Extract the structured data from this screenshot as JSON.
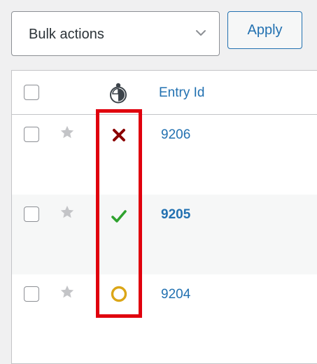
{
  "toolbar": {
    "bulk_actions_selected": "Bulk actions",
    "apply_label": "Apply"
  },
  "table": {
    "columns": {
      "entry_id": "Entry Id"
    },
    "rows": [
      {
        "entry_id": "9206",
        "status": "rejected",
        "status_icon": "x-mark-icon",
        "status_color": "#8b0000",
        "bold": false
      },
      {
        "entry_id": "9205",
        "status": "approved",
        "status_icon": "check-mark-icon",
        "status_color": "#2ea22e",
        "bold": true
      },
      {
        "entry_id": "9204",
        "status": "pending",
        "status_icon": "circle-icon",
        "status_color": "#dba617",
        "bold": false
      }
    ]
  },
  "colors": {
    "link": "#2271b1",
    "highlight": "#e0000d",
    "star": "#c3c4c7"
  }
}
